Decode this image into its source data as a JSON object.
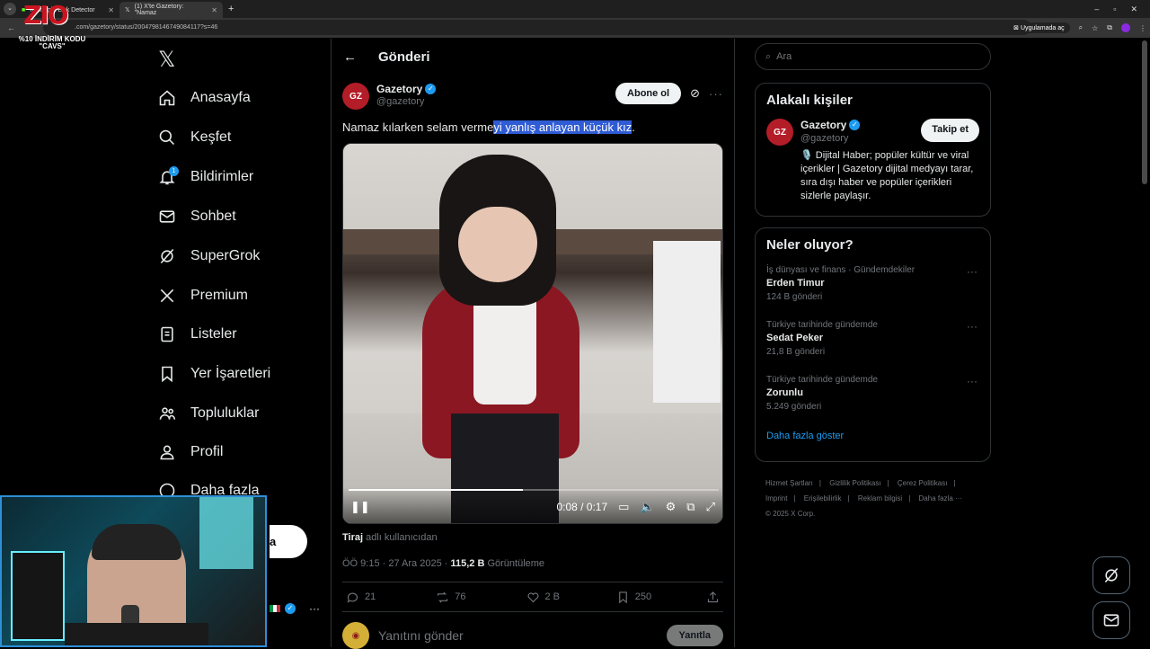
{
  "browser": {
    "tabs": [
      {
        "label": "KickSight Link Detector",
        "active": false
      },
      {
        "label": "(1) X'te Gazetory: \"Namaz",
        "active": true
      }
    ],
    "url": ".com/gazetory/status/2004798146749084117?s=46",
    "app_button": "Uygulamada aç"
  },
  "overlay": {
    "brand": "ZIO",
    "promo_line1": "%10 İNDİRİM KODU",
    "promo_line2": "\"CAVS\""
  },
  "nav": {
    "items": [
      {
        "label": "Anasayfa",
        "icon": "home-icon"
      },
      {
        "label": "Keşfet",
        "icon": "search-icon"
      },
      {
        "label": "Bildirimler",
        "icon": "bell-icon",
        "badge": "1"
      },
      {
        "label": "Sohbet",
        "icon": "mail-icon"
      },
      {
        "label": "SuperGrok",
        "icon": "grok-icon"
      },
      {
        "label": "Premium",
        "icon": "x-icon"
      },
      {
        "label": "Listeler",
        "icon": "list-icon"
      },
      {
        "label": "Yer İşaretleri",
        "icon": "bookmark-icon"
      },
      {
        "label": "Topluluklar",
        "icon": "people-icon"
      },
      {
        "label": "Profil",
        "icon": "person-icon"
      },
      {
        "label": "Daha fazla",
        "icon": "more-circle-icon"
      }
    ],
    "post_fragment": "a",
    "user_more": "···"
  },
  "main": {
    "header_title": "Gönderi",
    "tweet": {
      "author_name": "Gazetory",
      "author_handle": "@gazetory",
      "avatar_text": "GZ",
      "subscribe_label": "Abone ol",
      "text_before": "Namaz kılarken selam verme",
      "text_highlight": "yi yanlış anlayan küçük kız",
      "text_after": ".",
      "video_time": "0:08 / 0:17",
      "video_progress": 0.47,
      "via_user": "Tiraj",
      "via_suffix": "adlı kullanıcıdan",
      "timestamp": "ÖÖ 9:15 · 27 Ara 2025 · ",
      "views": "115,2 B",
      "views_label": "Görüntüleme",
      "replies": "21",
      "reposts": "76",
      "likes": "2 B",
      "bookmarks": "250"
    },
    "reply_placeholder": "Yanıtını gönder",
    "reply_button": "Yanıtla"
  },
  "right": {
    "search_placeholder": "Ara",
    "relevant": {
      "title": "Alakalı kişiler",
      "name": "Gazetory",
      "handle": "@gazetory",
      "bio": "🎙️ Dijital Haber; popüler kültür ve viral içerikler | Gazetory dijital medyayı tarar, sıra dışı haber ve popüler içerikleri sizlerle paylaşır.",
      "follow_label": "Takip et"
    },
    "trends": {
      "title": "Neler oluyor?",
      "items": [
        {
          "context": "İş dünyası ve finans · Gündemdekiler",
          "title": "Erden Timur",
          "count": "124 B gönderi"
        },
        {
          "context": "Türkiye tarihinde gündemde",
          "title": "Sedat Peker",
          "count": "21,8 B gönderi"
        },
        {
          "context": "Türkiye tarihinde gündemde",
          "title": "Zorunlu",
          "count": "5.249 gönderi"
        }
      ],
      "show_more": "Daha fazla göster"
    },
    "footer": {
      "links": [
        "Hizmet Şartları",
        "Gizlilik Politikası",
        "Çerez Politikası",
        "Imprint",
        "Erişilebilirlik",
        "Reklam bilgisi",
        "Daha fazla ···"
      ],
      "copyright": "© 2025 X Corp."
    }
  }
}
